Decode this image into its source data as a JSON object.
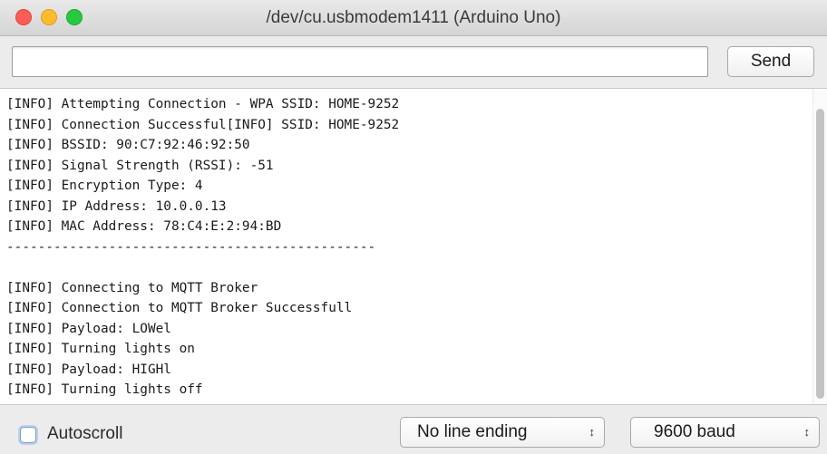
{
  "window": {
    "title": "/dev/cu.usbmodem1411 (Arduino Uno)"
  },
  "input": {
    "value": "",
    "send_label": "Send"
  },
  "output": {
    "lines": [
      "[INFO] Attempting Connection - WPA SSID: HOME-9252",
      "[INFO] Connection Successful[INFO] SSID: HOME-9252",
      "[INFO] BSSID: 90:C7:92:46:92:50",
      "[INFO] Signal Strength (RSSI): -51",
      "[INFO] Encryption Type: 4",
      "[INFO] IP Address: 10.0.0.13",
      "[INFO] MAC Address: 78:C4:E:2:94:BD",
      "-----------------------------------------------",
      "",
      "[INFO] Connecting to MQTT Broker",
      "[INFO] Connection to MQTT Broker Successfull",
      "[INFO] Payload: LOWel",
      "[INFO] Turning lights on",
      "[INFO] Payload: HIGHl",
      "[INFO] Turning lights off"
    ]
  },
  "footer": {
    "autoscroll_label": "Autoscroll",
    "autoscroll_checked": false,
    "line_ending": "No line ending",
    "baud_rate": "9600 baud"
  },
  "icons": {
    "close": "traffic-light-red",
    "minimize": "traffic-light-yellow",
    "zoom": "traffic-light-green",
    "select_arrows": "updown-arrows"
  },
  "colors": {
    "close": "#fc5b57",
    "minimize": "#fdbb2d",
    "zoom": "#27c93f",
    "focus": "#6f9fd6"
  }
}
